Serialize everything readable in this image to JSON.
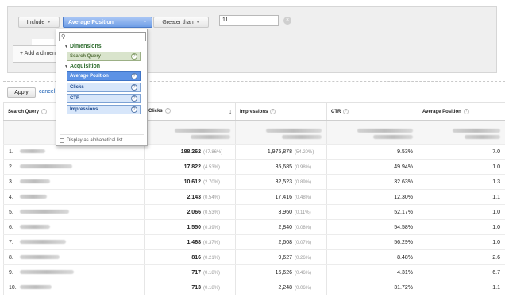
{
  "filter": {
    "include_label": "Include",
    "metric_label": "Average Position",
    "condition_label": "Greater than",
    "value": "11",
    "add_dimension_label": "+ Add a dimen"
  },
  "actions": {
    "apply": "Apply",
    "cancel": "cancel"
  },
  "dropdown": {
    "search_placeholder": "",
    "groups": [
      {
        "label": "Dimensions",
        "items": [
          "Search Query"
        ]
      },
      {
        "label": "Acquisition",
        "items": [
          "Average Position",
          "Clicks",
          "CTR",
          "Impressions"
        ]
      }
    ],
    "selected": "Average Position",
    "alphabetical_label": "Display as alphabetical list"
  },
  "table": {
    "columns": [
      "Search Query",
      "Clicks",
      "Impressions",
      "CTR",
      "Average Position"
    ],
    "sorted_column": "Clicks",
    "rows": [
      {
        "rank": "1.",
        "clicks": "188,262",
        "clicks_pct": "(47.86%)",
        "impressions": "1,975,878",
        "impressions_pct": "(54.20%)",
        "ctr": "9.53%",
        "avg_pos": "7.0"
      },
      {
        "rank": "2.",
        "clicks": "17,822",
        "clicks_pct": "(4.53%)",
        "impressions": "35,685",
        "impressions_pct": "(0.98%)",
        "ctr": "49.94%",
        "avg_pos": "1.0"
      },
      {
        "rank": "3.",
        "clicks": "10,612",
        "clicks_pct": "(2.70%)",
        "impressions": "32,523",
        "impressions_pct": "(0.89%)",
        "ctr": "32.63%",
        "avg_pos": "1.3"
      },
      {
        "rank": "4.",
        "clicks": "2,143",
        "clicks_pct": "(0.54%)",
        "impressions": "17,416",
        "impressions_pct": "(0.48%)",
        "ctr": "12.30%",
        "avg_pos": "1.1"
      },
      {
        "rank": "5.",
        "clicks": "2,066",
        "clicks_pct": "(0.53%)",
        "impressions": "3,960",
        "impressions_pct": "(0.11%)",
        "ctr": "52.17%",
        "avg_pos": "1.0"
      },
      {
        "rank": "6.",
        "clicks": "1,550",
        "clicks_pct": "(0.39%)",
        "impressions": "2,840",
        "impressions_pct": "(0.08%)",
        "ctr": "54.58%",
        "avg_pos": "1.0"
      },
      {
        "rank": "7.",
        "clicks": "1,468",
        "clicks_pct": "(0.37%)",
        "impressions": "2,608",
        "impressions_pct": "(0.07%)",
        "ctr": "56.29%",
        "avg_pos": "1.0"
      },
      {
        "rank": "8.",
        "clicks": "816",
        "clicks_pct": "(0.21%)",
        "impressions": "9,627",
        "impressions_pct": "(0.26%)",
        "ctr": "8.48%",
        "avg_pos": "2.6"
      },
      {
        "rank": "9.",
        "clicks": "717",
        "clicks_pct": "(0.18%)",
        "impressions": "16,626",
        "impressions_pct": "(0.46%)",
        "ctr": "4.31%",
        "avg_pos": "6.7"
      },
      {
        "rank": "10.",
        "clicks": "713",
        "clicks_pct": "(0.18%)",
        "impressions": "2,248",
        "impressions_pct": "(0.06%)",
        "ctr": "31.72%",
        "avg_pos": "1.1"
      }
    ]
  },
  "icons": {
    "search": "magnifier-icon",
    "help": "help-icon",
    "remove": "remove-icon",
    "sort": "sort-down-icon"
  },
  "colors": {
    "selected_item": "#5c92e5",
    "acquisition_item": "#d7e6fa",
    "dimension_item": "#d9e4cc",
    "group_label": "#2b6a2b",
    "link": "#1a5fb4"
  }
}
